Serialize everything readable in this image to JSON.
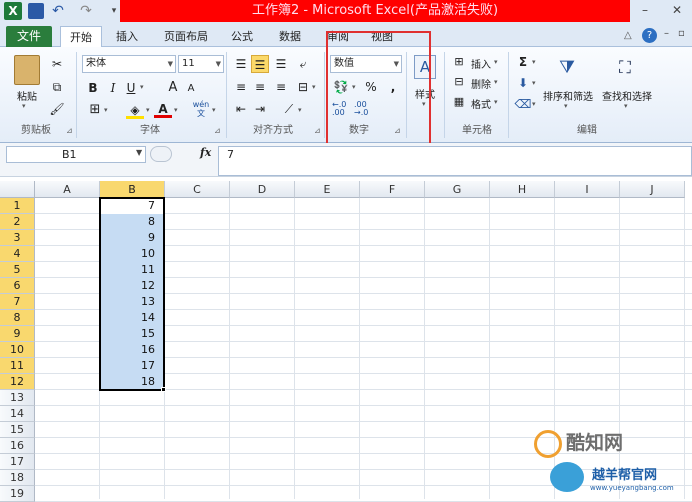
{
  "app": {
    "title": "工作簿2 - Microsoft Excel(产品激活失败)",
    "excel_icon": "X"
  },
  "ribbon": {
    "file_tab": "文件",
    "tabs": [
      {
        "label": "开始",
        "active": true
      },
      {
        "label": "插入"
      },
      {
        "label": "页面布局"
      },
      {
        "label": "公式"
      },
      {
        "label": "数据"
      },
      {
        "label": "审阅"
      },
      {
        "label": "视图"
      }
    ],
    "groups": {
      "clipboard": {
        "label": "剪贴板",
        "paste": "粘贴"
      },
      "font": {
        "label": "字体",
        "font_name": "宋体",
        "font_size": "11",
        "bold": "B",
        "italic": "I",
        "underline": "U",
        "grow": "A",
        "shrink": "A",
        "color_letter": "A",
        "wen": "wén\n文"
      },
      "alignment": {
        "label": "对齐方式"
      },
      "number": {
        "label": "数字",
        "format": "数值",
        "percent": "%",
        "comma": ","
      },
      "styles": {
        "label": "样式",
        "letter": "A"
      },
      "cells": {
        "label": "单元格",
        "insert": "插入",
        "delete": "删除",
        "format": "格式"
      },
      "editing": {
        "label": "编辑",
        "sort_filter": "排序和筛选",
        "find_select": "查找和选择",
        "sigma": "Σ"
      }
    }
  },
  "formula_bar": {
    "name_box": "B1",
    "fx": "fx",
    "content": "7"
  },
  "sheet": {
    "columns": [
      "A",
      "B",
      "C",
      "D",
      "E",
      "F",
      "G",
      "H",
      "I",
      "J"
    ],
    "rows": [
      "1",
      "2",
      "3",
      "4",
      "5",
      "6",
      "7",
      "8",
      "9",
      "10",
      "11",
      "12",
      "13",
      "14",
      "15",
      "16",
      "17",
      "18",
      "19"
    ],
    "column_b_values": [
      "7",
      "8",
      "9",
      "10",
      "11",
      "12",
      "13",
      "14",
      "15",
      "16",
      "17",
      "18"
    ]
  },
  "watermark": {
    "line1": "酷知网",
    "line2": "越羊帮官网",
    "line3": "www.yueyangbang.com"
  },
  "colors": {
    "title_red": "#ff0000",
    "file_tab_green": "#2a7d3c",
    "selection_fill": "#c6dcf3",
    "header_highlight": "#f9d86e",
    "annotation_red": "#e03030"
  }
}
